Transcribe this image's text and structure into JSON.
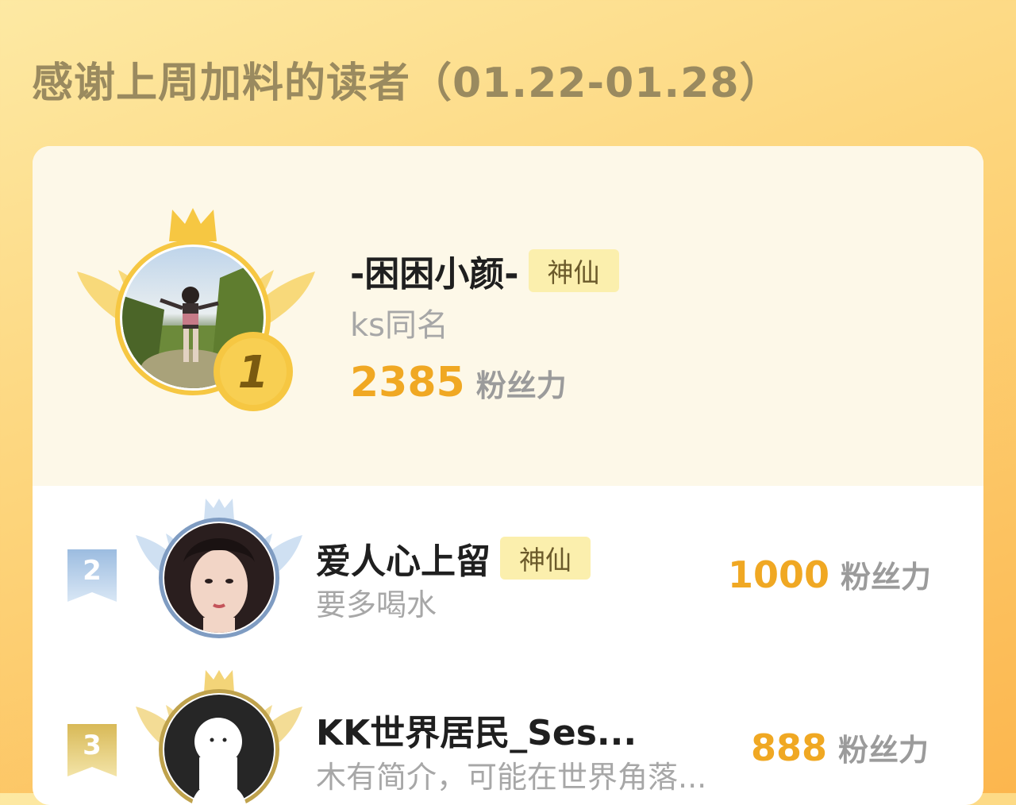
{
  "header": {
    "title": "感谢上周加料的读者（01.22-01.28）"
  },
  "colors": {
    "accent": "#f0a823",
    "gold": "#f6c742",
    "silver": "#9cbce0",
    "bronze": "#e0c269"
  },
  "readers": [
    {
      "rank": "1",
      "name": "-困困小颜-",
      "badge": "神仙",
      "bio": "ks同名",
      "score": "2385",
      "unit": "粉丝力",
      "avatar_icon": "user-photo"
    },
    {
      "rank": "2",
      "name": "爱人心上留",
      "badge": "神仙",
      "bio": "要多喝水",
      "score": "1000",
      "unit": "粉丝力",
      "avatar_icon": "user-photo"
    },
    {
      "rank": "3",
      "name": "KK世界居民_Ses...",
      "badge": "",
      "bio": "木有简介，可能在世界角落...",
      "score": "888",
      "unit": "粉丝力",
      "avatar_icon": "default-ghost-avatar"
    }
  ]
}
